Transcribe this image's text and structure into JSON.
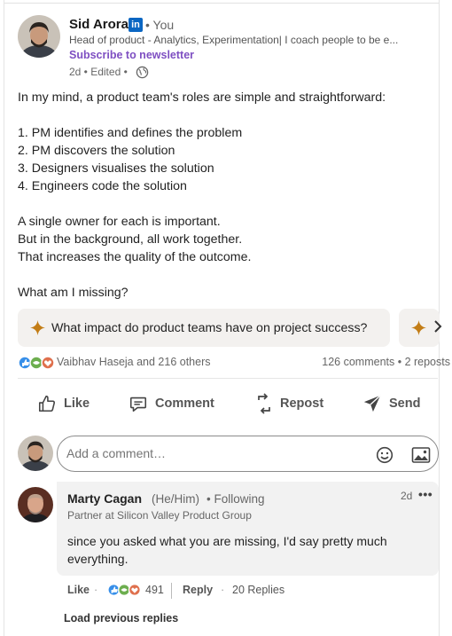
{
  "post": {
    "author": {
      "name": "Sid Arora",
      "badge": "in",
      "relation": "• You",
      "headline": "Head of product - Analytics, Experimentation| I coach people to be e...",
      "subscribe_label": "Subscribe to newsletter",
      "meta": "2d • Edited •"
    },
    "body": {
      "intro": "In my mind, a product team's roles are simple and straightforward:",
      "list": [
        "1. PM identifies and defines the problem",
        "2. PM discovers the solution",
        "3. Designers visualises the solution",
        "4. Engineers code the solution"
      ],
      "para": [
        "A single owner for each is important.",
        "But in the background, all work together.",
        "That increases the quality of the outcome."
      ],
      "closing": "What am I missing?"
    },
    "suggestions": [
      "What impact do product teams have on project success?"
    ],
    "reactions": {
      "names": "Vaibhav Haseja and 216 others",
      "comments_reposts": "126 comments • 2 reposts"
    },
    "actions": {
      "like": "Like",
      "comment": "Comment",
      "repost": "Repost",
      "send": "Send"
    }
  },
  "composer": {
    "placeholder": "Add a comment…"
  },
  "comment": {
    "name": "Marty Cagan",
    "pronouns": "(He/Him)",
    "following": "• Following",
    "time": "2d",
    "more": "•••",
    "headline": "Partner at Silicon Valley Product Group",
    "text": "since you asked what you are missing, I'd say pretty much everything.",
    "footer": {
      "like": "Like",
      "reaction_count": "491",
      "reply": "Reply",
      "replies": "20 Replies"
    }
  },
  "load_previous": "Load previous replies",
  "colors": {
    "brand_blue": "#0a66c2",
    "newsletter_purple": "#7e4fc2",
    "suggestion_bg": "#f3f1ef",
    "spark_gold": "#c37d16"
  }
}
